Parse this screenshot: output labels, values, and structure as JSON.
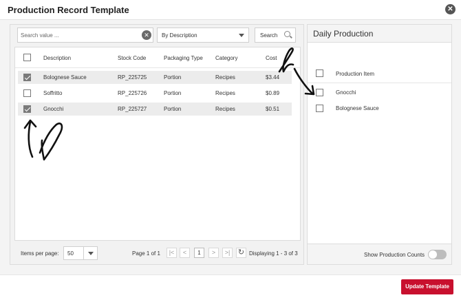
{
  "modal": {
    "title": "Production Record Template"
  },
  "search": {
    "placeholder": "Search value ...",
    "value": "",
    "filter_selected": "By Description",
    "search_label": "Search"
  },
  "table": {
    "columns": [
      "Description",
      "Stock Code",
      "Packaging Type",
      "Category",
      "Cost"
    ],
    "rows": [
      {
        "checked": true,
        "description": "Bolognese Sauce",
        "stock_code": "RP_225725",
        "packaging": "Portion",
        "category": "Recipes",
        "cost": "$3.44"
      },
      {
        "checked": false,
        "description": "Soffritto",
        "stock_code": "RP_225726",
        "packaging": "Portion",
        "category": "Recipes",
        "cost": "$0.89"
      },
      {
        "checked": true,
        "description": "Gnocchi",
        "stock_code": "RP_225727",
        "packaging": "Portion",
        "category": "Recipes",
        "cost": "$0.51"
      }
    ]
  },
  "pager": {
    "items_per_page_label": "Items per page:",
    "items_per_page_value": "50",
    "page_label": "Page 1 of 1",
    "current_page": "1",
    "first": "|<",
    "prev": "<",
    "next": ">",
    "last": ">|",
    "displaying": "Displaying 1 - 3 of 3"
  },
  "daily": {
    "title": "Daily Production",
    "column": "Production Item",
    "items": [
      {
        "checked": false,
        "label": "Gnocchi"
      },
      {
        "checked": false,
        "label": "Bolognese Sauce"
      }
    ],
    "show_counts_label": "Show Production Counts",
    "show_counts_on": false
  },
  "footer": {
    "update_label": "Update Template"
  },
  "colors": {
    "primary": "#c8102e",
    "check": "#7a7a7a"
  }
}
